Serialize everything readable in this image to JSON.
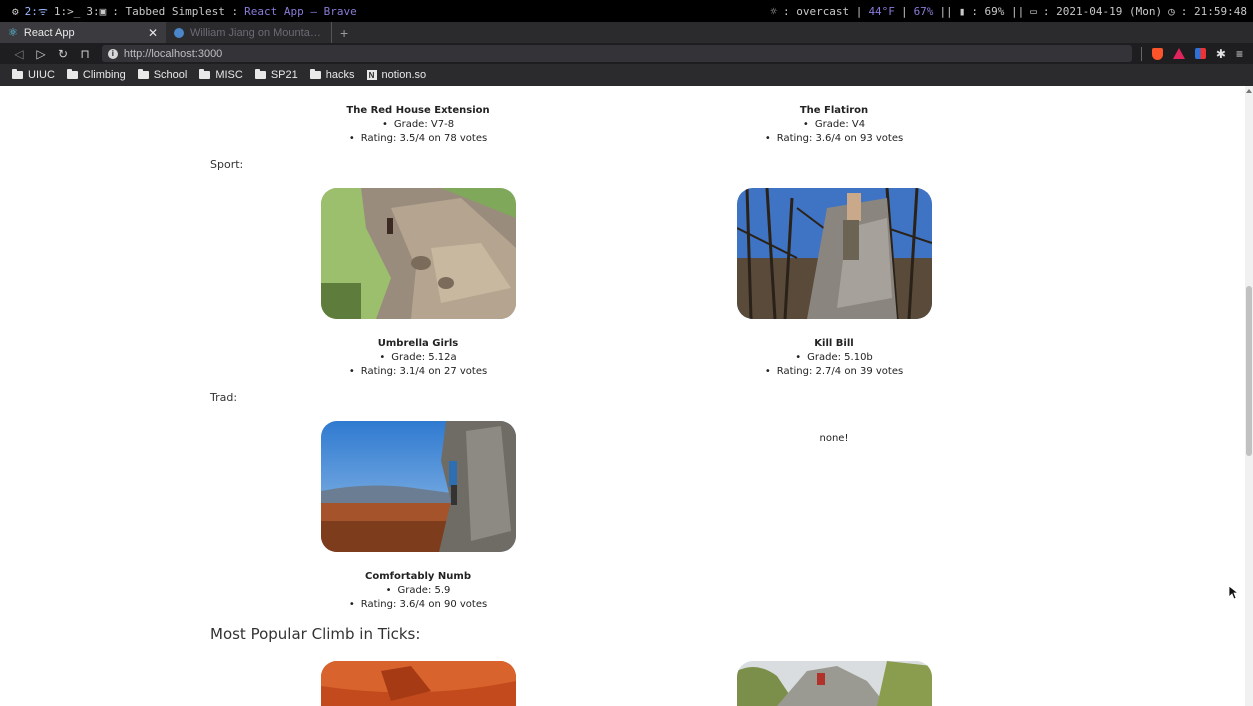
{
  "statusbar": {
    "workspaces": [
      "2:",
      "1:",
      "3:"
    ],
    "window_prefix": ": Tabbed Simplest :",
    "window_title": "React App — Brave",
    "weather_label": ": overcast |",
    "temp": "44°F",
    "humidity": "67%",
    "battery": ": 69% ||",
    "date": ": 2021-04-19 (Mon)",
    "time": ": 21:59:48"
  },
  "tabs": [
    {
      "label": "React App",
      "active": true
    },
    {
      "label": "William Jiang on Mountain Proj",
      "active": false
    }
  ],
  "address": {
    "url": "http://localhost:3000"
  },
  "bookmarks": [
    "UIUC",
    "Climbing",
    "School",
    "MISC",
    "SP21",
    "hacks",
    "notion.so"
  ],
  "content": {
    "boulder_row": [
      {
        "name": "The Red House Extension",
        "grade": "Grade: V7-8",
        "rating": "Rating: 3.5/4 on 78 votes"
      },
      {
        "name": "The Flatiron",
        "grade": "Grade: V4",
        "rating": "Rating: 3.6/4 on 93 votes"
      }
    ],
    "sport_label": "Sport:",
    "sport_row": [
      {
        "name": "Umbrella Girls",
        "grade": "Grade: 5.12a",
        "rating": "Rating: 3.1/4 on 27 votes"
      },
      {
        "name": "Kill Bill",
        "grade": "Grade: 5.10b",
        "rating": "Rating: 2.7/4 on 39 votes"
      }
    ],
    "trad_label": "Trad:",
    "trad_row": [
      {
        "name": "Comfortably Numb",
        "grade": "Grade: 5.9",
        "rating": "Rating: 3.6/4 on 90 votes"
      }
    ],
    "trad_none": "none!",
    "popular_heading": "Most Popular Climb in Ticks:"
  },
  "colors": {
    "accent_purple": "#8b7bd8",
    "brave_orange": "#fb542b",
    "react_blue": "#61dafb"
  }
}
